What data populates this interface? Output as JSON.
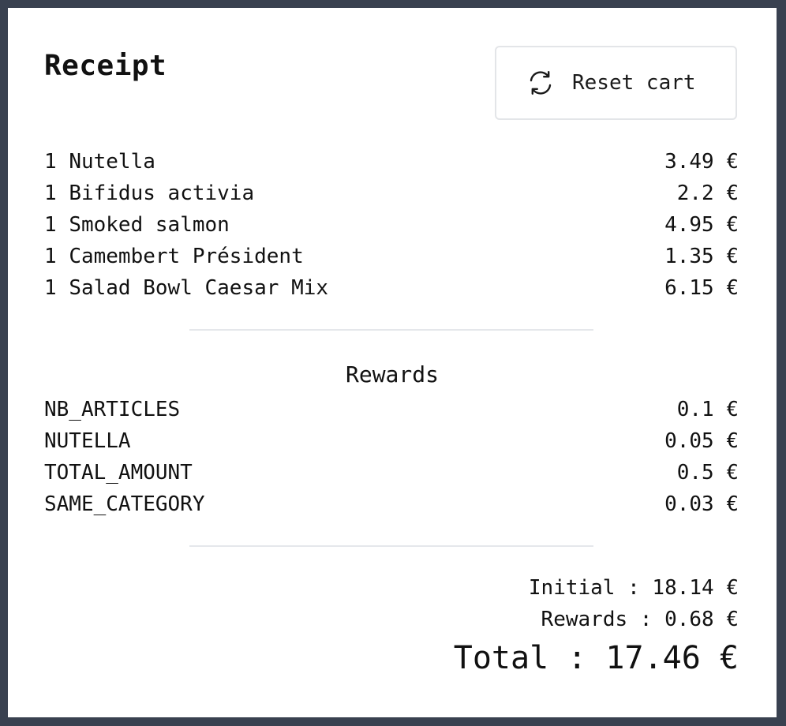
{
  "receipt": {
    "title": "Receipt",
    "reset_label": "Reset cart",
    "items": [
      {
        "qty": "1",
        "name": "Nutella",
        "price": "3.49 €"
      },
      {
        "qty": "1",
        "name": "Bifidus activia",
        "price": "2.2 €"
      },
      {
        "qty": "1",
        "name": "Smoked salmon",
        "price": "4.95 €"
      },
      {
        "qty": "1",
        "name": "Camembert Président",
        "price": "1.35 €"
      },
      {
        "qty": "1",
        "name": "Salad Bowl Caesar Mix",
        "price": "6.15 €"
      }
    ],
    "rewards_heading": "Rewards",
    "rewards": [
      {
        "name": "NB_ARTICLES",
        "amount": "0.1 €"
      },
      {
        "name": "NUTELLA",
        "amount": "0.05 €"
      },
      {
        "name": "TOTAL_AMOUNT",
        "amount": "0.5 €"
      },
      {
        "name": "SAME_CATEGORY",
        "amount": "0.03 €"
      }
    ],
    "summary": {
      "initial": "Initial : 18.14 €",
      "rewards": "Rewards : 0.68 €",
      "total": "Total : 17.46 €"
    }
  },
  "icons": {
    "reset": "refresh-icon"
  },
  "colors": {
    "page_background": "#394150",
    "panel_background": "#ffffff",
    "divider": "#e5e7eb",
    "button_border": "#e3e5e8",
    "text": "#111111"
  }
}
